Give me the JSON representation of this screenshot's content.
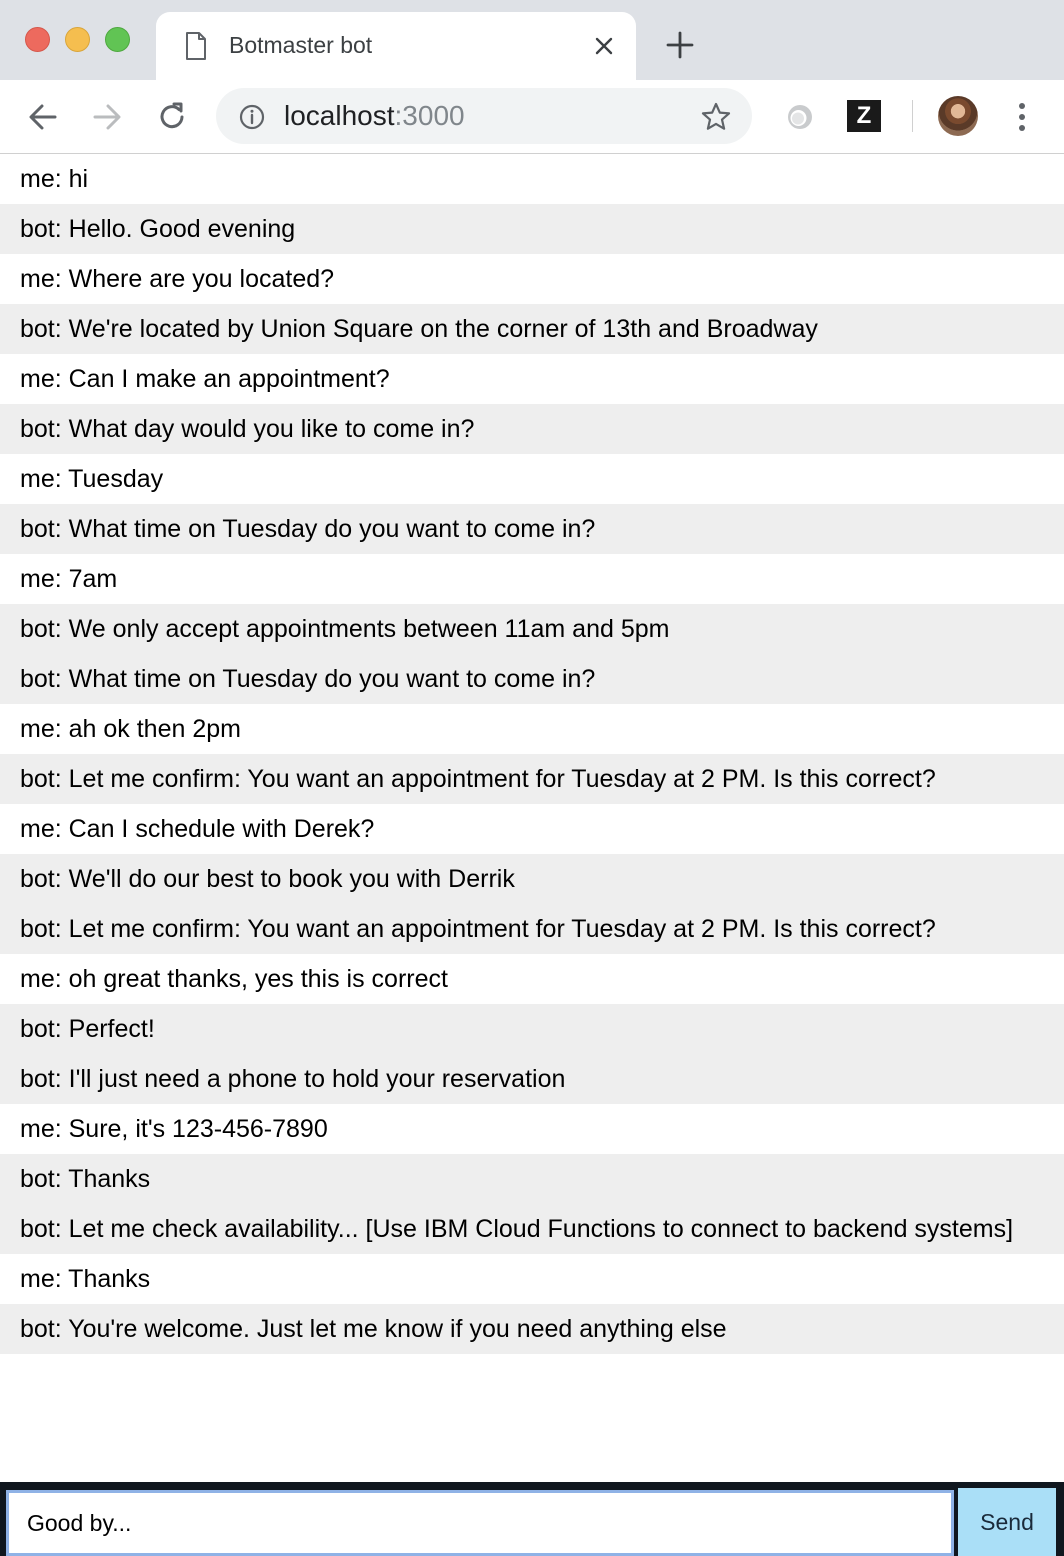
{
  "browser": {
    "tab_title": "Botmaster bot",
    "url_host": "localhost",
    "url_port": ":3000",
    "extension_letter": "Z"
  },
  "messages": [
    {
      "sender": "me",
      "text": "me: hi"
    },
    {
      "sender": "bot",
      "text": "bot: Hello. Good evening"
    },
    {
      "sender": "me",
      "text": "me: Where are you located?"
    },
    {
      "sender": "bot",
      "text": "bot: We're located by Union Square on the corner of 13th and Broadway"
    },
    {
      "sender": "me",
      "text": "me: Can I make an appointment?"
    },
    {
      "sender": "bot",
      "text": "bot: What day would you like to come in?"
    },
    {
      "sender": "me",
      "text": "me: Tuesday"
    },
    {
      "sender": "bot",
      "text": "bot: What time on Tuesday do you want to come in?"
    },
    {
      "sender": "me",
      "text": "me: 7am"
    },
    {
      "sender": "bot",
      "text": "bot: We only accept appointments between 11am and 5pm"
    },
    {
      "sender": "bot",
      "text": "bot: What time on Tuesday do you want to come in?"
    },
    {
      "sender": "me",
      "text": "me: ah ok then 2pm"
    },
    {
      "sender": "bot",
      "text": "bot: Let me confirm: You want an appointment for Tuesday at 2 PM. Is this correct?"
    },
    {
      "sender": "me",
      "text": "me: Can I schedule with Derek?"
    },
    {
      "sender": "bot",
      "text": "bot: We'll do our best to book you with Derrik"
    },
    {
      "sender": "bot",
      "text": "bot: Let me confirm: You want an appointment for Tuesday at 2 PM. Is this correct?"
    },
    {
      "sender": "me",
      "text": "me: oh great thanks, yes this is correct"
    },
    {
      "sender": "bot",
      "text": "bot: Perfect!"
    },
    {
      "sender": "bot",
      "text": "bot: I'll just need a phone to hold your reservation"
    },
    {
      "sender": "me",
      "text": "me: Sure, it's 123-456-7890"
    },
    {
      "sender": "bot",
      "text": "bot: Thanks"
    },
    {
      "sender": "bot",
      "text": "bot: Let me check availability... [Use IBM Cloud Functions to connect to backend systems]"
    },
    {
      "sender": "me",
      "text": "me: Thanks"
    },
    {
      "sender": "bot",
      "text": "bot: You're welcome. Just let me know if you need anything else"
    }
  ],
  "composer": {
    "input_value": "Good by...",
    "send_label": "Send"
  },
  "icons": {
    "tab": "document-icon",
    "close": "close-icon",
    "new_tab": "plus-icon",
    "back": "arrow-left-icon",
    "forward": "arrow-right-icon",
    "reload": "reload-icon",
    "info": "info-icon",
    "bookmark": "star-icon",
    "menu": "kebab-menu-icon"
  },
  "colors": {
    "bot_row": "#eeeeee",
    "me_row": "#ffffff",
    "send_button": "#aadff7",
    "input_bar": "#10171f"
  }
}
